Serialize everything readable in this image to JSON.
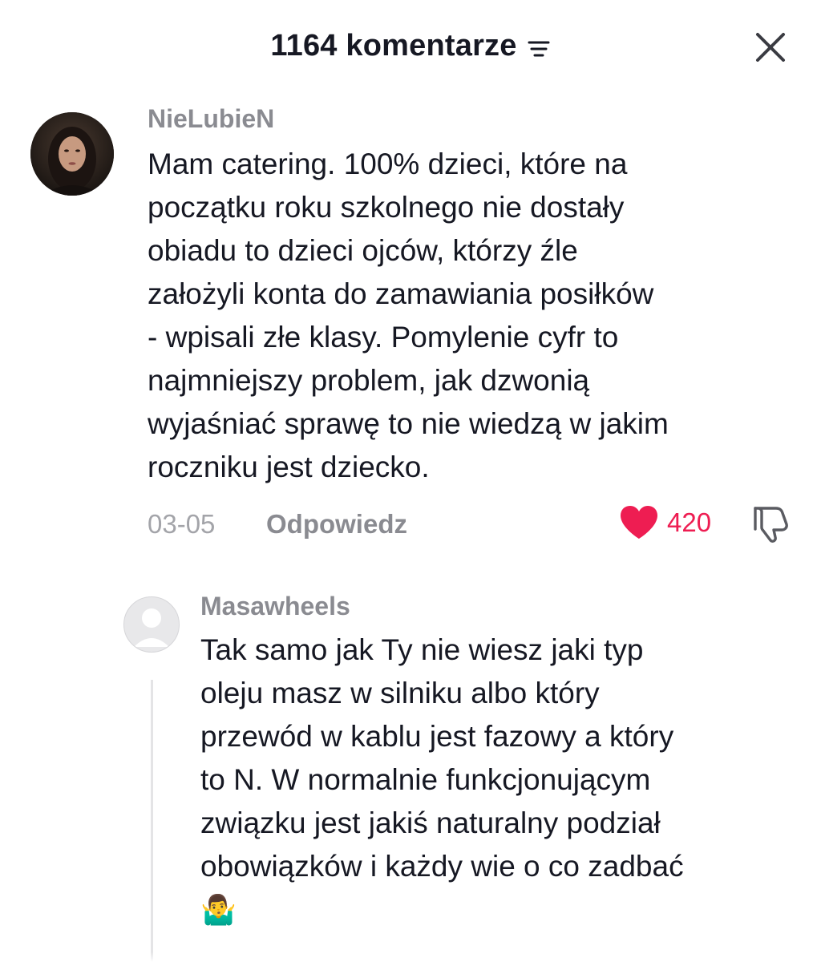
{
  "header": {
    "title": "1164 komentarze",
    "sort_icon": "sort-lines-icon",
    "close_icon": "close-icon"
  },
  "comments": [
    {
      "username": "NieLubieN",
      "text": "Mam catering. 100% dzieci, które na\npoczątku roku szkolnego nie dostały\nobiadu to dzieci ojców, którzy źle\nzałożyli konta do zamawiania posiłków\n- wpisali złe klasy. Pomylenie cyfr to\nnajmniejszy problem, jak dzwonią\nwyjaśniać sprawę to nie wiedzą w jakim\nroczniku jest dziecko.",
      "date": "03-05",
      "reply_label": "Odpowiedz",
      "likes": "420",
      "liked": true
    }
  ],
  "replies": [
    {
      "username": "Masawheels",
      "text": "Tak samo jak Ty nie wiesz jaki typ\noleju masz w silniku albo który\nprzewód w kablu jest fazowy a który\nto N. W normalnie funkcjonującym\nzwiązku jest jakiś naturalny podział\nobowiązków i każdy wie o co zadbać",
      "emoji": "🤷‍♂️"
    }
  ],
  "colors": {
    "accent_like": "#ee1d52",
    "text_primary": "#161823",
    "text_secondary": "#8a8b91"
  }
}
